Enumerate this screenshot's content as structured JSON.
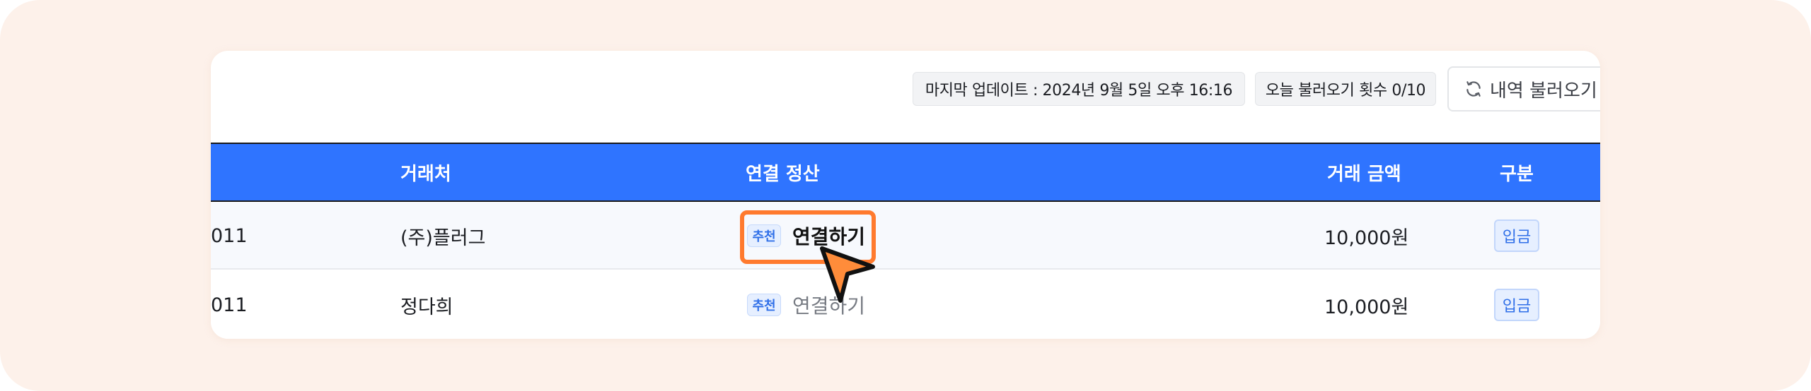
{
  "toolbar": {
    "last_update": "마지막 업데이트 : 2024년 9월 5일 오후 16:16",
    "fetch_count": "오늘 불러오기 횟수 0/10",
    "reload_label": "내역 불러오기"
  },
  "table": {
    "headers": {
      "counterparty": "거래처",
      "linked_settlement": "연결 정산",
      "amount": "거래 금액",
      "category": "구분"
    },
    "rows": [
      {
        "date_suffix": "011",
        "counterparty": "(주)플러그",
        "tag": "추천",
        "link_label": "연결하기",
        "amount": "10,000원",
        "category": "입금"
      },
      {
        "date_suffix": "011",
        "counterparty": "정다희",
        "tag": "추천",
        "link_label": "연결하기",
        "amount": "10,000원",
        "category": "입금"
      }
    ]
  },
  "colors": {
    "header_bg": "#2f74ff",
    "highlight": "#ff7a2e",
    "page_bg": "#fdf1ea"
  },
  "icons": {
    "reload": "refresh-icon",
    "cursor": "pointer-cursor-icon"
  }
}
